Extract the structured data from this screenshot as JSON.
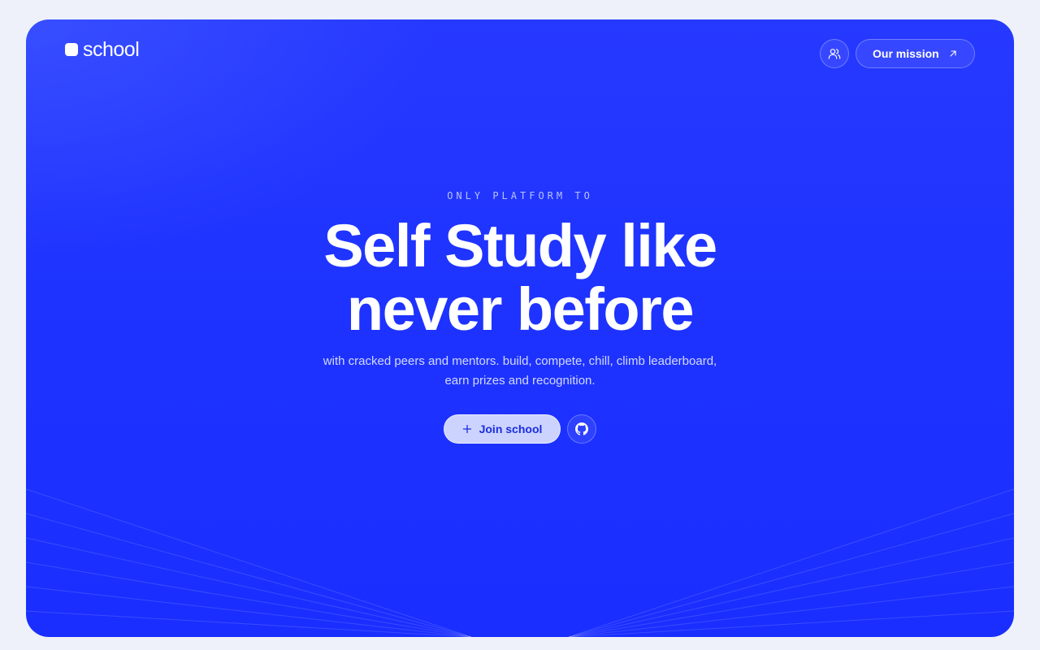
{
  "brand": {
    "name": "school",
    "primary_color": "#1e33ff",
    "accent_light": "#ccd3ff"
  },
  "nav": {
    "community_icon": "users-icon",
    "mission_label": "Our mission",
    "mission_icon": "arrow-up-right-icon"
  },
  "hero": {
    "eyebrow": "ONLY PLATFORM TO",
    "headline_line1": "Self Study like",
    "headline_line2": "never before",
    "subtitle_line1": "with cracked peers and mentors. build, compete, chill, climb leaderboard,",
    "subtitle_line2": "earn prizes and recognition."
  },
  "cta": {
    "join_label": "Join school",
    "join_icon": "plus-icon",
    "github_icon": "github-icon"
  }
}
